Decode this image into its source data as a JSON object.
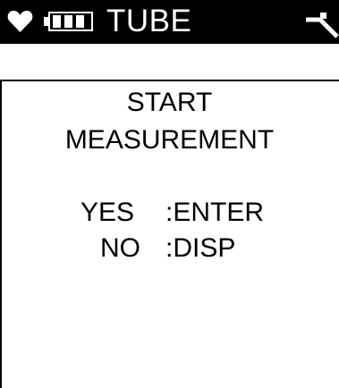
{
  "status_bar": {
    "title": "TUBE",
    "icons": [
      "heart-icon",
      "battery-icon",
      "signal-icon"
    ],
    "background": "#000000",
    "foreground": "#ffffff"
  },
  "prompt": {
    "line1": "START",
    "line2": "MEASUREMENT"
  },
  "options": {
    "yes_label": "YES",
    "yes_key": ":ENTER",
    "no_label": "NO",
    "no_key": ":DISP"
  }
}
